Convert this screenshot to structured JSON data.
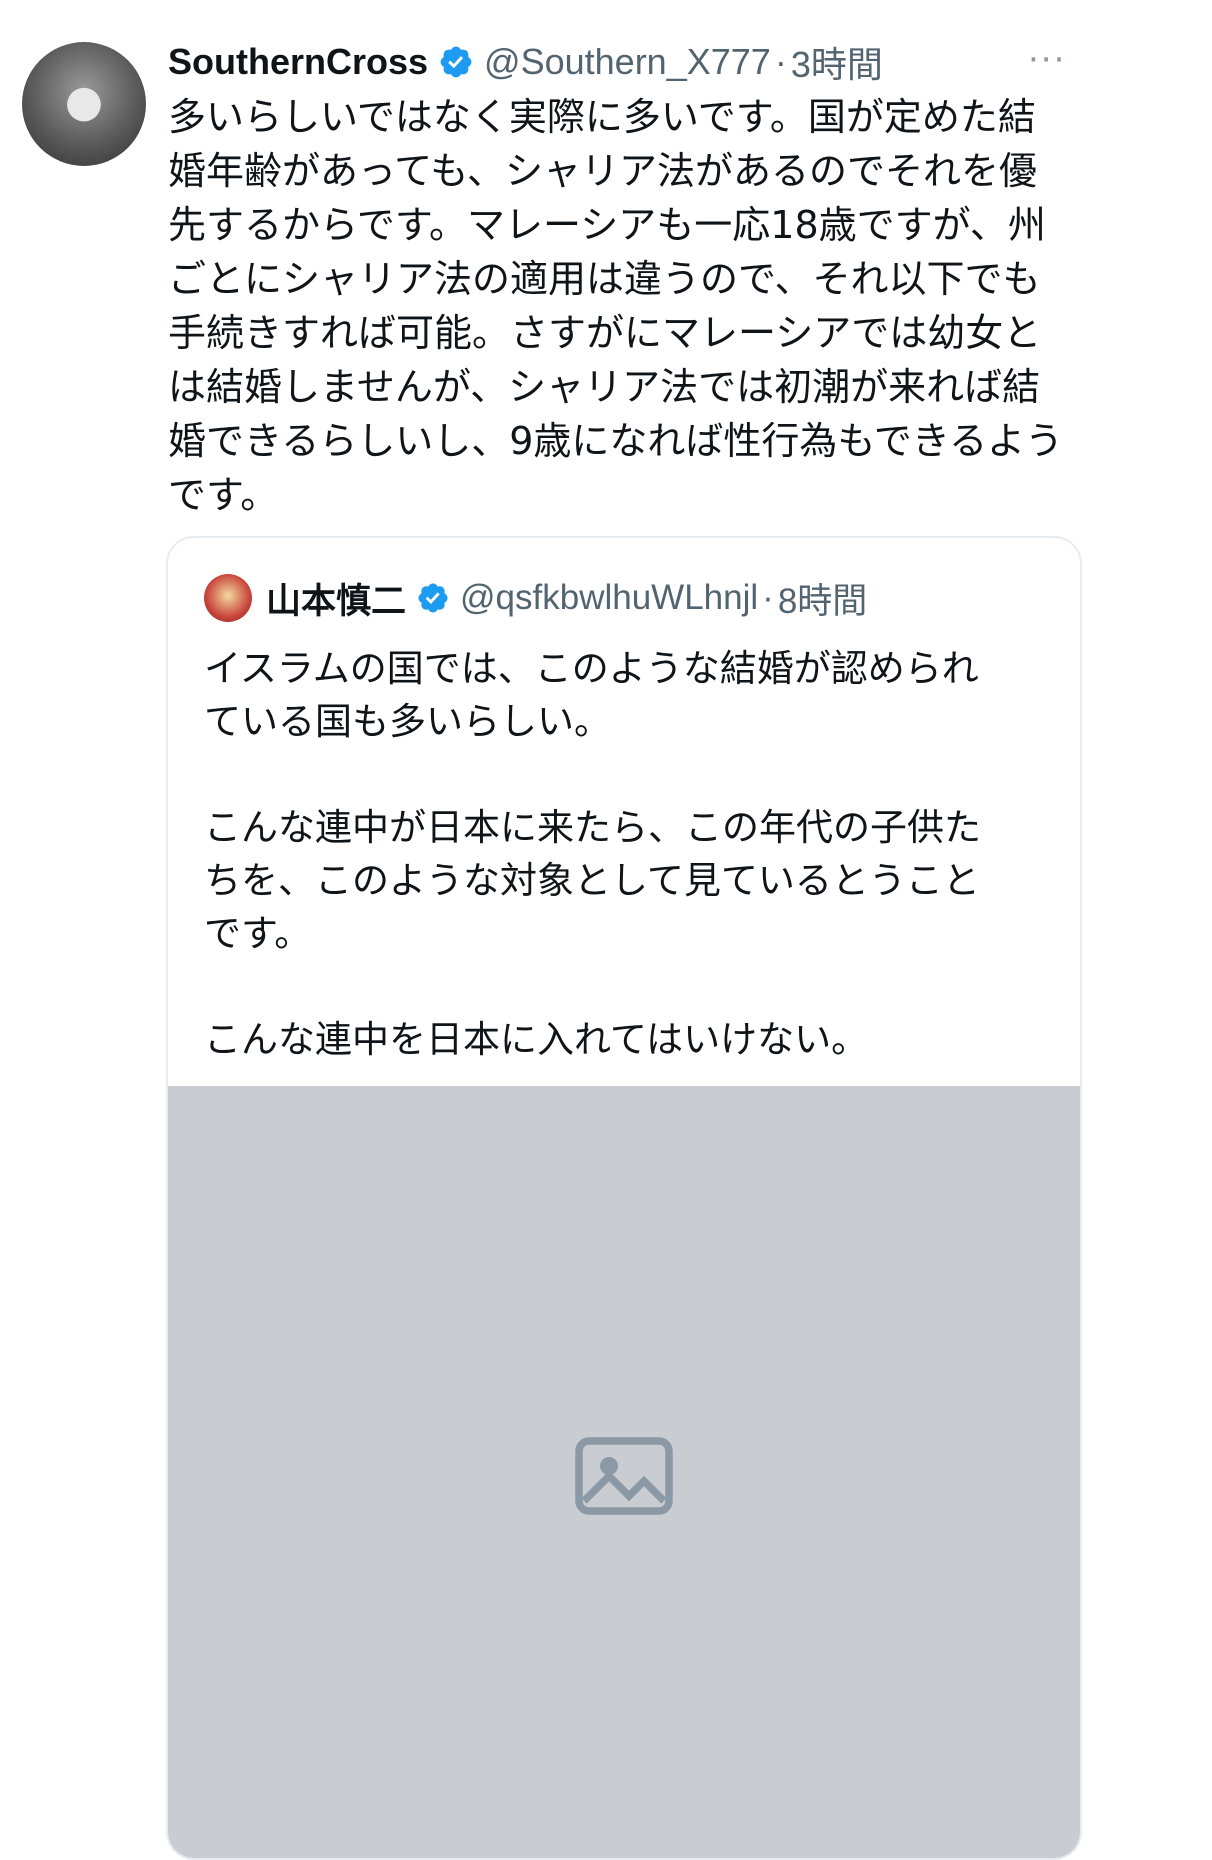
{
  "tweet": {
    "author": {
      "display_name": "SouthernCross",
      "handle": "@Southern_X777",
      "verified": true
    },
    "separator": "·",
    "time": "3時間",
    "more_label": "···",
    "body_lines": [
      "多いらしいではなく実際に多いです。国が定めた結",
      "婚年齢があっても、シャリア法があるのでそれを優",
      "先するからです。マレーシアも一応18歳ですが、州",
      "ごとにシャリア法の適用は違うので、それ以下でも",
      "手続きすれば可能。さすがにマレーシアでは幼女と",
      "は結婚しませんが、シャリア法では初潮が来れば結",
      "婚できるらしいし、9歳になれば性行為もできるよう",
      "です。"
    ]
  },
  "quoted_tweet": {
    "author": {
      "display_name": "山本慎二",
      "handle": "@qsfkbwlhuWLhnjl",
      "verified": true
    },
    "separator": "·",
    "time": "8時間",
    "paragraphs": [
      [
        "イスラムの国では、このような結婚が認められ",
        "ている国も多いらしい。"
      ],
      [
        "こんな連中が日本に来たら、この年代の子供た",
        "ちを、このような対象として見ているとうこと",
        "です。"
      ],
      [
        "こんな連中を日本に入れてはいけない。"
      ]
    ],
    "has_media": true
  },
  "colors": {
    "text_primary": "#0f1419",
    "text_secondary": "#536471",
    "verified_blue": "#1d9bf0",
    "border": "#e6ecf0"
  }
}
